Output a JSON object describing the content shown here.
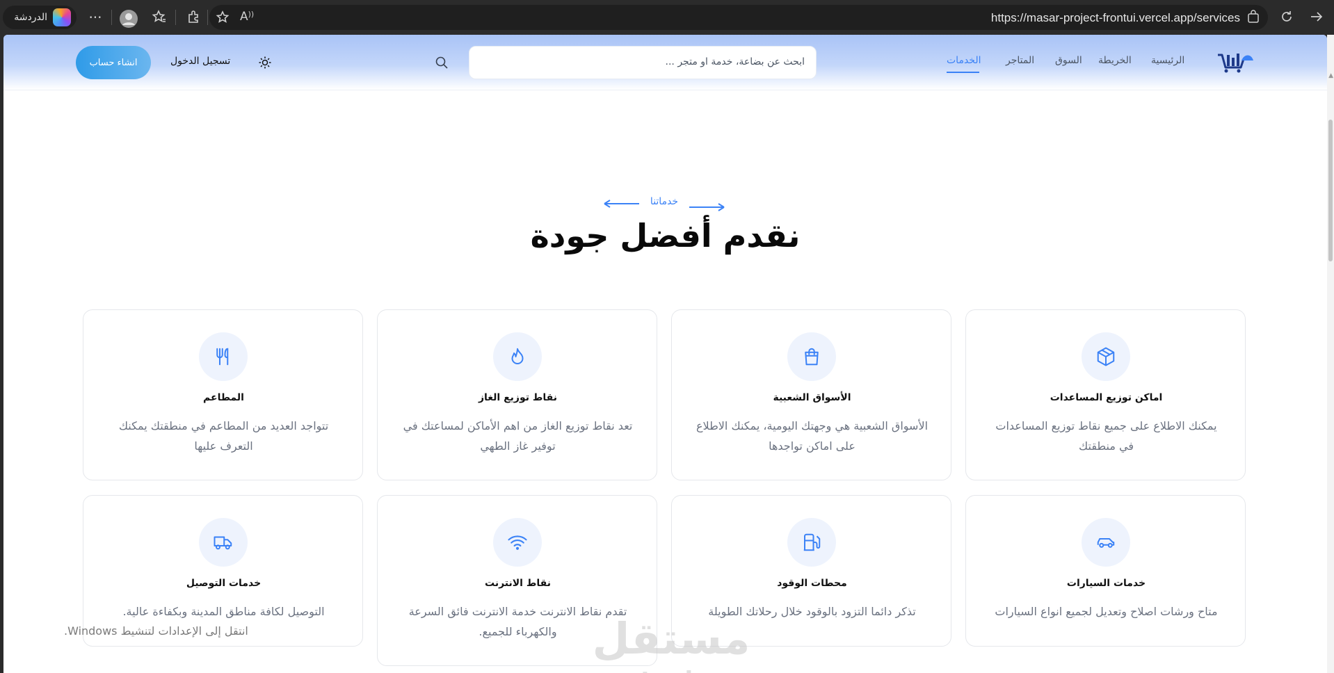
{
  "browser": {
    "chat_label": "الدردشة",
    "url": "https://masar-project-frontui.vercel.app/services"
  },
  "nav": {
    "items": [
      {
        "label": "الرئيسية",
        "active": false
      },
      {
        "label": "الخريطة",
        "active": false
      },
      {
        "label": "السوق",
        "active": false
      },
      {
        "label": "المتاجر",
        "active": false
      },
      {
        "label": "الخدمات",
        "active": true
      }
    ],
    "search_placeholder": "ابحث عن بضاعة، خدمة او متجر ...",
    "login_label": "تسجيل الدخول",
    "signup_label": "انشاء حساب"
  },
  "section": {
    "eyebrow": "خدماتنا",
    "title": "نقدم أفضل جودة"
  },
  "cards": [
    {
      "icon": "box-icon",
      "title": "اماكن توزيع المساعدات",
      "desc": "يمكنك الاطلاع على جميع نقاط توزيع المساعدات في منطقتك"
    },
    {
      "icon": "shopping-bag-icon",
      "title": "الأسواق الشعبية",
      "desc": "الأسواق الشعبية هي وجهتك اليومية، يمكنك الاطلاع على اماكن تواجدها"
    },
    {
      "icon": "flame-icon",
      "title": "نقاط توزيع الغاز",
      "desc": "تعد نقاط توزيع الغاز من اهم الأماكن لمساعتك في توفير غاز الطهي"
    },
    {
      "icon": "utensils-icon",
      "title": "المطاعم",
      "desc": "تتواجد العديد من المطاعم في منطقتك يمكنك التعرف عليها"
    },
    {
      "icon": "car-icon",
      "title": "خدمات السيارات",
      "desc": "متاح ورشات اصلاح وتعديل لجميع انواع السيارات"
    },
    {
      "icon": "fuel-icon",
      "title": "محطات الوقود",
      "desc": "تذكر دائما التزود بالوقود خلال رحلاتك الطويلة"
    },
    {
      "icon": "wifi-icon",
      "title": "نقاط الانترنت",
      "desc": "تقدم نقاط الانترنت خدمة الانترنت فائق السرعة والكهرباء للجميع."
    },
    {
      "icon": "truck-icon",
      "title": "خدمات التوصيل",
      "desc": "التوصيل لكافة مناطق المدينة وبكفاءة عالية."
    }
  ],
  "overlay": {
    "windows_activation": "انتقل إلى الإعدادات لتنشيط Windows.",
    "brand_watermark_arabic": "مستقل",
    "brand_watermark_latin": "mostaql.com"
  },
  "colors": {
    "accent": "#3b82f6",
    "header_gradient_top": "#a9c3f6",
    "signup_gradient": "#2f9be8"
  }
}
